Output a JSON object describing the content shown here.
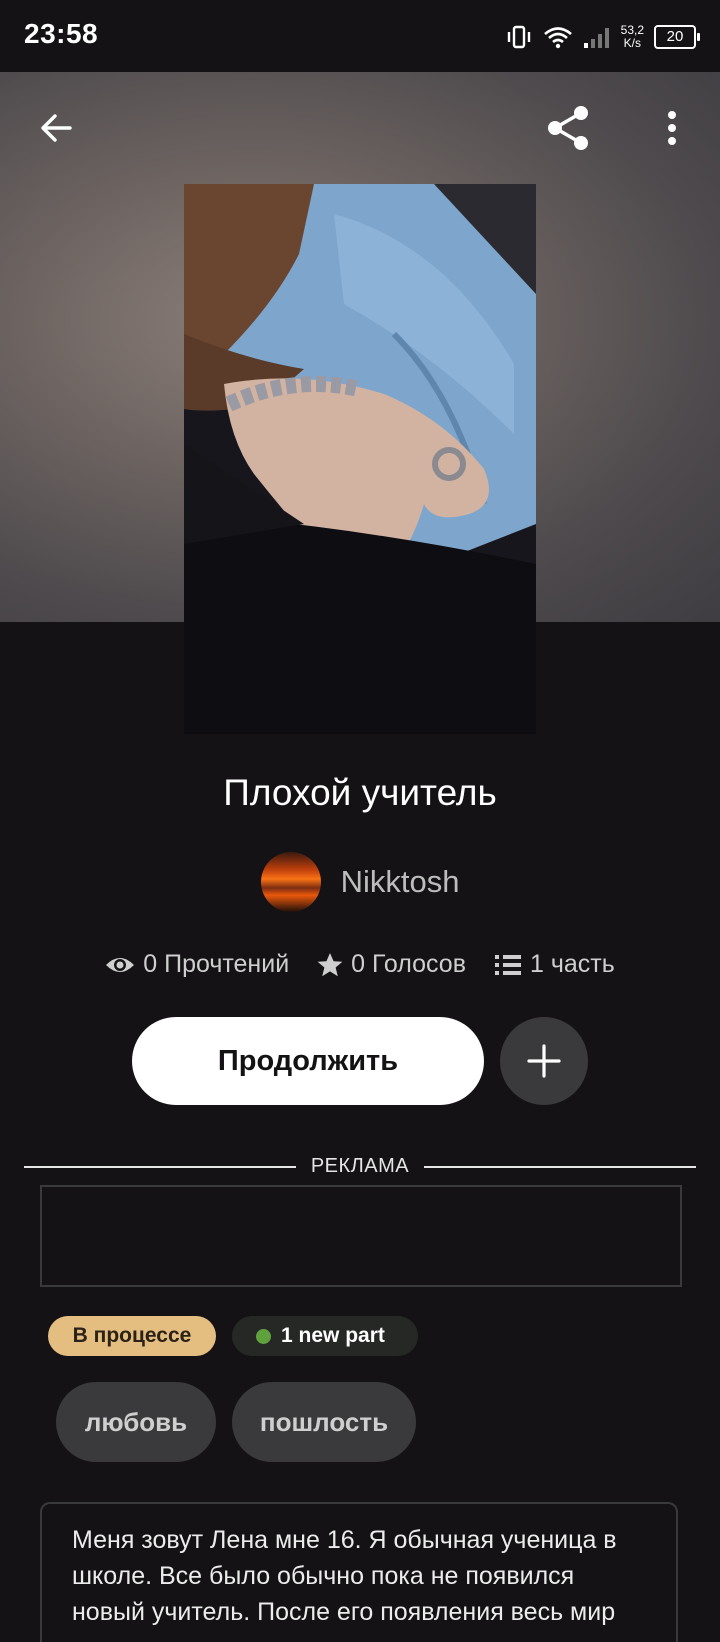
{
  "status_bar": {
    "time": "23:58",
    "speed_value": "53,2",
    "speed_unit": "K/s",
    "battery": "20"
  },
  "story": {
    "title": "Плохой учитель",
    "author": "Nikktosh",
    "stats": {
      "reads": "0 Прочтений",
      "votes": "0 Голосов",
      "parts": "1 часть"
    },
    "continue_label": "Продолжить",
    "ad_label": "РЕКЛАМА",
    "status_chip": "В процессе",
    "new_part_chip": "1 new part",
    "tags": [
      "любовь",
      "пошлость"
    ],
    "description": "Меня зовут Лена мне 16. Я обычная ученица в школе. Все было обычно пока не появился новый учитель. После его появления весь мир"
  },
  "colors": {
    "background": "#141214",
    "status_chip": "#e3be80",
    "new_dot": "#5fa13d",
    "button_dark": "#3a3a3c"
  },
  "icons": [
    "back-arrow-icon",
    "share-icon",
    "more-vert-icon",
    "eye-icon",
    "star-icon",
    "list-icon",
    "plus-icon",
    "vibrate-icon",
    "wifi-icon",
    "signal-icon"
  ]
}
